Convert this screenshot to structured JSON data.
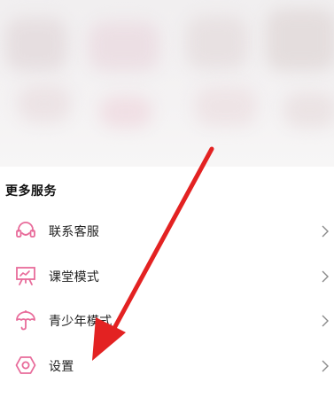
{
  "section": {
    "title": "更多服务"
  },
  "menu": [
    {
      "label": "联系客服",
      "icon": "headset-icon"
    },
    {
      "label": "课堂模式",
      "icon": "classroom-board-icon"
    },
    {
      "label": "青少年模式",
      "icon": "umbrella-icon"
    },
    {
      "label": "设置",
      "icon": "hexagon-settings-icon"
    }
  ],
  "colors": {
    "icon_pink": "#e86b9a",
    "annotation_arrow": "#e32222",
    "chevron": "#8a8a8a"
  }
}
